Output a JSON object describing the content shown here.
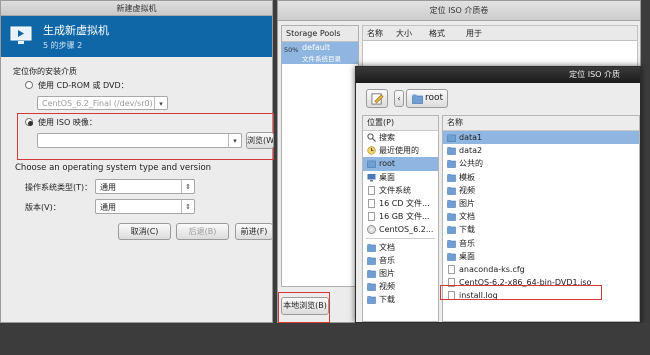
{
  "wizard": {
    "title": "新建虚拟机",
    "heading": "生成新虚拟机",
    "step": "5 的步骤 2",
    "install_media_label": "定位你的安装介质",
    "cdrom_option": "使用 CD-ROM 或 DVD：",
    "cdrom_value": "CentOS_6.2_Final (/dev/sr0)",
    "iso_option": "使用 ISO 映像：",
    "iso_path_value": "",
    "browse_button": "浏览(W)...",
    "os_section": "Choose an operating system type and version",
    "os_type_label": "操作系统类型(T)：",
    "os_type_value": "通用",
    "version_label": "版本(V)：",
    "version_value": "通用",
    "cancel_button": "取消(C)",
    "back_button": "后退(B)",
    "forward_button": "前进(F)"
  },
  "locate_iso": {
    "title": "定位 ISO 介质卷",
    "pools_header": "Storage Pools",
    "pool_usage": "50%",
    "pool_name": "default",
    "pool_type": "文件系统目录",
    "columns": [
      "名称",
      "大小",
      "格式",
      "用于"
    ],
    "browse_local_button": "本地浏览(B)"
  },
  "file_chooser": {
    "title": "定位 ISO 介质",
    "path_button": "root",
    "places_header": "位置(P)",
    "name_header": "名称",
    "places": [
      {
        "label": "搜索",
        "icon": "search-icon"
      },
      {
        "label": "最近使用的",
        "icon": "recent-icon"
      },
      {
        "label": "root",
        "icon": "home-folder-icon",
        "selected": true
      },
      {
        "label": "桌面",
        "icon": "desktop-icon"
      },
      {
        "label": "文件系统",
        "icon": "filesystem-icon"
      },
      {
        "label": "16 CD 文件...",
        "icon": "drive-icon"
      },
      {
        "label": "16 GB 文件...",
        "icon": "drive-icon"
      },
      {
        "label": "CentOS_6.2...",
        "icon": "disc-icon"
      },
      {
        "label": "文档",
        "icon": "folder-icon"
      },
      {
        "label": "音乐",
        "icon": "folder-icon"
      },
      {
        "label": "图片",
        "icon": "folder-icon"
      },
      {
        "label": "视频",
        "icon": "folder-icon"
      },
      {
        "label": "下载",
        "icon": "folder-icon"
      }
    ],
    "files": [
      {
        "name": "data1",
        "kind": "folder",
        "selected": true
      },
      {
        "name": "data2",
        "kind": "folder"
      },
      {
        "name": "公共的",
        "kind": "folder"
      },
      {
        "name": "模板",
        "kind": "folder"
      },
      {
        "name": "视频",
        "kind": "folder"
      },
      {
        "name": "图片",
        "kind": "folder"
      },
      {
        "name": "文档",
        "kind": "folder"
      },
      {
        "name": "下载",
        "kind": "folder"
      },
      {
        "name": "音乐",
        "kind": "folder"
      },
      {
        "name": "桌面",
        "kind": "folder"
      },
      {
        "name": "anaconda-ks.cfg",
        "kind": "file"
      },
      {
        "name": "CentOS-6.2-x86_64-bin-DVD1.iso",
        "kind": "file"
      },
      {
        "name": "install.log",
        "kind": "file"
      }
    ]
  },
  "colors": {
    "header_blue": "#0f67a8",
    "selection_blue": "#8fb6e0",
    "highlight_red": "#d23a3a",
    "folder": "#6f9fd3"
  }
}
